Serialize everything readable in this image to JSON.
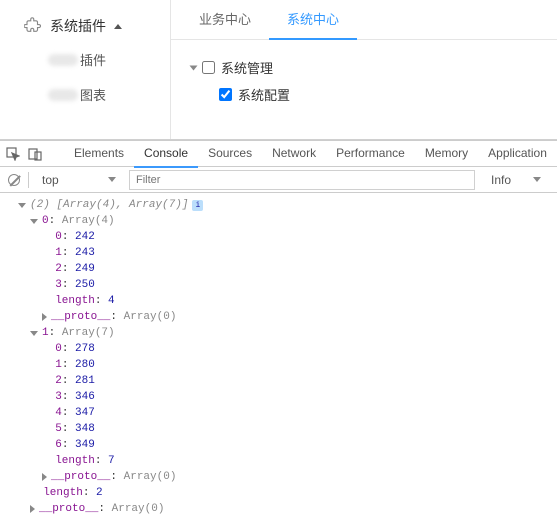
{
  "sidebar": {
    "header": "系统插件",
    "items": [
      {
        "label": "插件"
      },
      {
        "label": "图表"
      }
    ]
  },
  "tabs": [
    {
      "label": "业务中心",
      "active": false
    },
    {
      "label": "系统中心",
      "active": true
    }
  ],
  "tree": {
    "root": {
      "label": "系统管理",
      "checked": false
    },
    "child": {
      "label": "系统配置",
      "checked": true
    }
  },
  "devtools": {
    "tabs": [
      "Elements",
      "Console",
      "Sources",
      "Network",
      "Performance",
      "Memory",
      "Application"
    ],
    "active_tab": "Console",
    "context": "top",
    "filter_placeholder": "Filter",
    "level": "Info"
  },
  "console": {
    "summary_prefix": "(2) ",
    "summary_body": "[Array(4), Array(7)]",
    "arrays": [
      {
        "label": "0",
        "type": "Array(4)",
        "items": [
          242,
          243,
          249,
          250
        ],
        "length": 4,
        "proto": "Array(0)"
      },
      {
        "label": "1",
        "type": "Array(7)",
        "items": [
          278,
          280,
          281,
          346,
          347,
          348,
          349
        ],
        "length": 7,
        "proto": "Array(0)"
      }
    ],
    "outer_length": 2,
    "outer_proto": "Array(0)"
  }
}
